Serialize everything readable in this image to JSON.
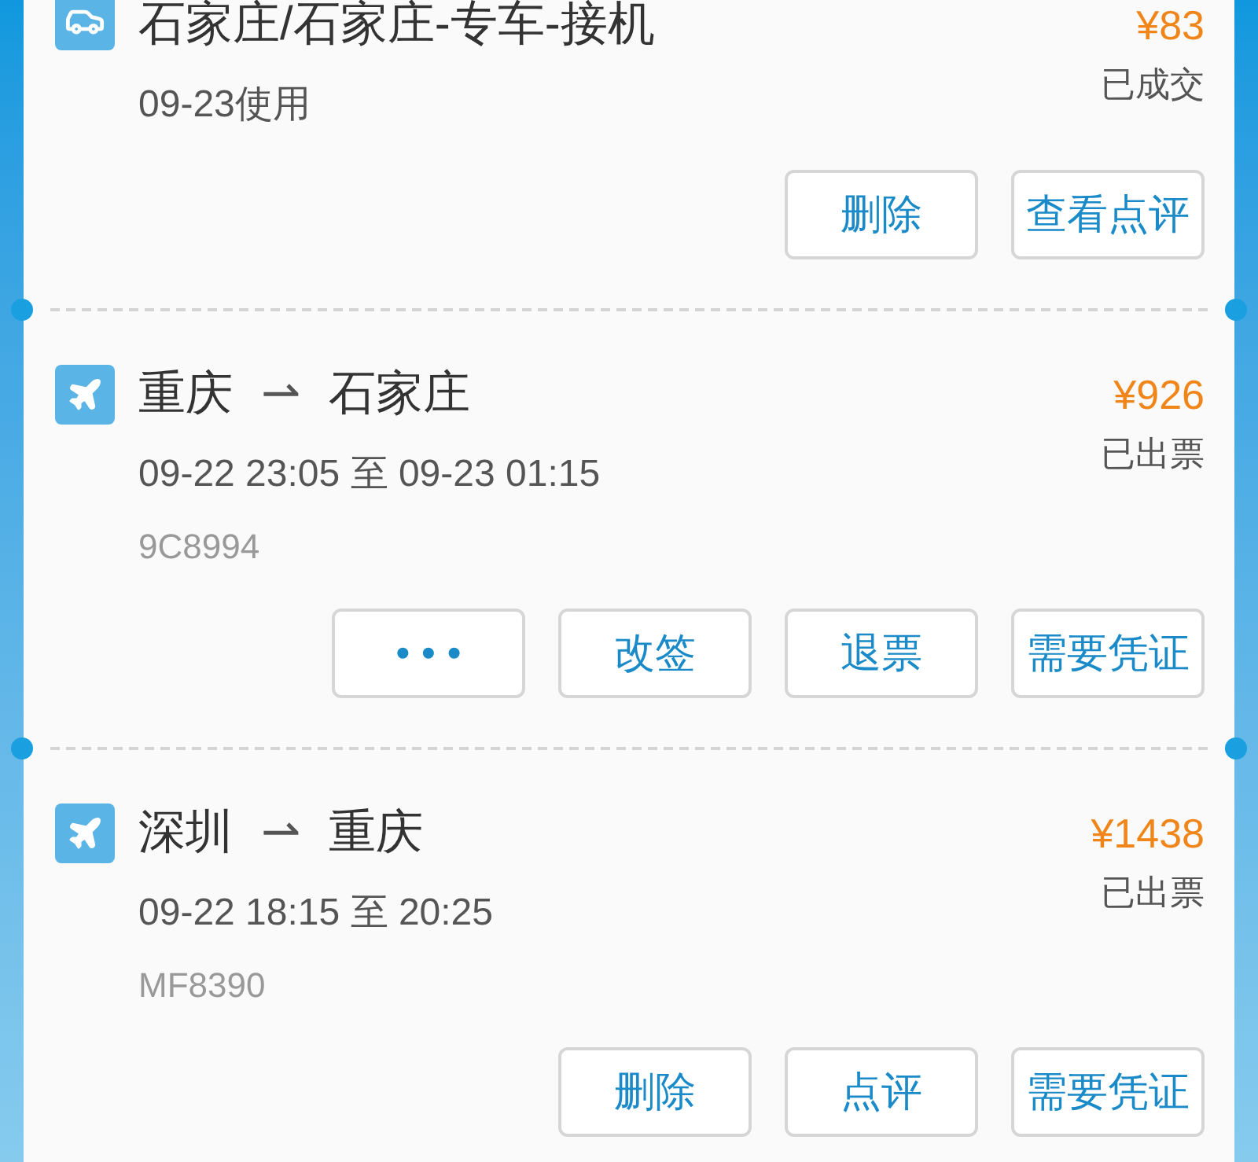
{
  "orders": [
    {
      "kind": "car",
      "title": "石家庄/石家庄-专车-接机",
      "price": "¥83",
      "status": "已成交",
      "date": "09-23使用",
      "buttons": [
        {
          "label": "删除"
        },
        {
          "label": "查看点评"
        }
      ]
    },
    {
      "kind": "flight",
      "from": "重庆",
      "arrow": "⇀",
      "to": "石家庄",
      "price": "¥926",
      "status": "已出票",
      "date": "09-22 23:05 至 09-23 01:15",
      "code": "9C8994",
      "buttons": [
        {
          "label": "• • •"
        },
        {
          "label": "改签"
        },
        {
          "label": "退票"
        },
        {
          "label": "需要凭证"
        }
      ]
    },
    {
      "kind": "flight",
      "from": "深圳",
      "arrow": "⇀",
      "to": "重庆",
      "price": "¥1438",
      "status": "已出票",
      "date": "09-22 18:15 至 20:25",
      "code": "MF8390",
      "buttons": [
        {
          "label": "删除"
        },
        {
          "label": "点评"
        },
        {
          "label": "需要凭证"
        }
      ]
    }
  ]
}
